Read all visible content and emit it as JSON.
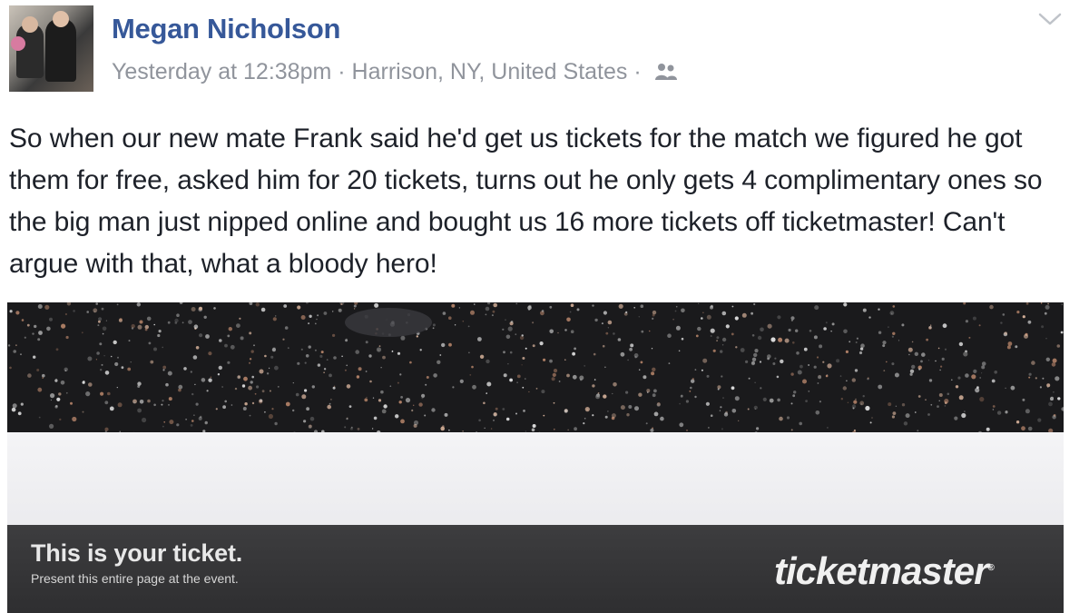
{
  "post": {
    "author": "Megan Nicholson",
    "timestamp": "Yesterday at 12:38pm",
    "separator": "·",
    "location": "Harrison, NY, United States",
    "privacy_icon": "friends-icon",
    "options_icon": "chevron-down-icon",
    "text": "So when our new mate Frank said he'd get us tickets for the match we figured he got them for free, asked him for 20 tickets, turns out he only gets 4 complimentary ones so the big man just nipped online and bought us 16 more tickets off ticketmaster! Can't argue with that, what a bloody hero!"
  },
  "photo": {
    "ticket_title": "This is your ticket.",
    "ticket_subtitle": "Present this entire page at the event.",
    "brand": "ticketmaster",
    "brand_mark": "®"
  },
  "colors": {
    "author_link": "#365899",
    "meta_text": "#90949c",
    "body_text": "#1d2129"
  }
}
